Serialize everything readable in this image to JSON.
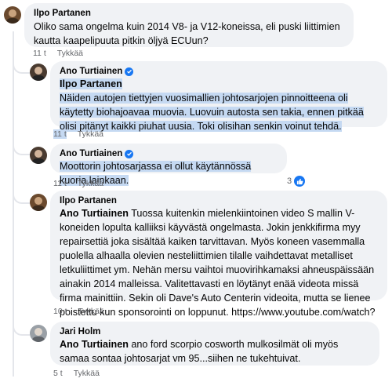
{
  "comments": [
    {
      "author": "Ilpo Partanen",
      "text": "Oliko sama ongelma kuin 2014 V8- ja V12-koneissa, eli puski liittimien kautta kaapelipuuta pitkin öljyä ECUun?",
      "time": "11 t",
      "like_label": "Tykkää"
    },
    {
      "author": "Ano Turtiainen",
      "tag": "Ilpo Partanen",
      "text": "Näiden autojen tiettyjen vuosimallien johtosarjojen pinnoitteena oli käytetty biohajoavaa muovia. Luovuin autosta sen takia, ennen pitkää olisi pitänyt kaikki piuhat uusia. Toki olisihan senkin voinut tehdä.",
      "time": "11 t",
      "like_label": "Tykkää"
    },
    {
      "author": "Ano Turtiainen",
      "text": "Moottorin johtosarjassa ei ollut käytännössä kuoria lainkaan.",
      "time": "11 t",
      "like_label": "Tykkää",
      "reactions": "3"
    },
    {
      "author": "Ilpo Partanen",
      "tag": "Ano Turtiainen",
      "text": "Tuossa kuitenkin mielenkiintoinen video S mallin V-koneiden lopulta kalliiksi käyvästä ongelmasta. Jokin jenkkifirma myy repairsettiä joka sisältää kaiken tarvittavan. Myös koneen vasemmalla puolella alhaalla olevien nesteliittimien tilalle vaihdettavat metalliset letkuliittimet ym. Nehän mersu vaihtoi muovirihkamaksi ahneuspäissään ainakin 2014 malleissa. Valitettavasti en löytänyt enää videota missä firma mainittiin. Sekin oli Dave's Auto Centerin videoita, mutta se lienee poistettu kun sponsorointi on loppunut. https://www.youtube.com/watch?v=bcF1CFKKuyI",
      "time": "10 t",
      "like_label": "Tykkää"
    },
    {
      "author": "Jari Holm",
      "tag": "Ano Turtiainen",
      "text": "ano ford scorpio cosworth mulkosilmät oli myös samaa sontaa johtosarjat vm 95...siihen ne tukehtuivat.",
      "time": "5 t",
      "like_label": "Tykkää"
    }
  ],
  "colors": {
    "bubble": "#f0f2f5",
    "highlight": "#c5d9f2",
    "verified": "#1877f2",
    "meta": "#65676b"
  }
}
